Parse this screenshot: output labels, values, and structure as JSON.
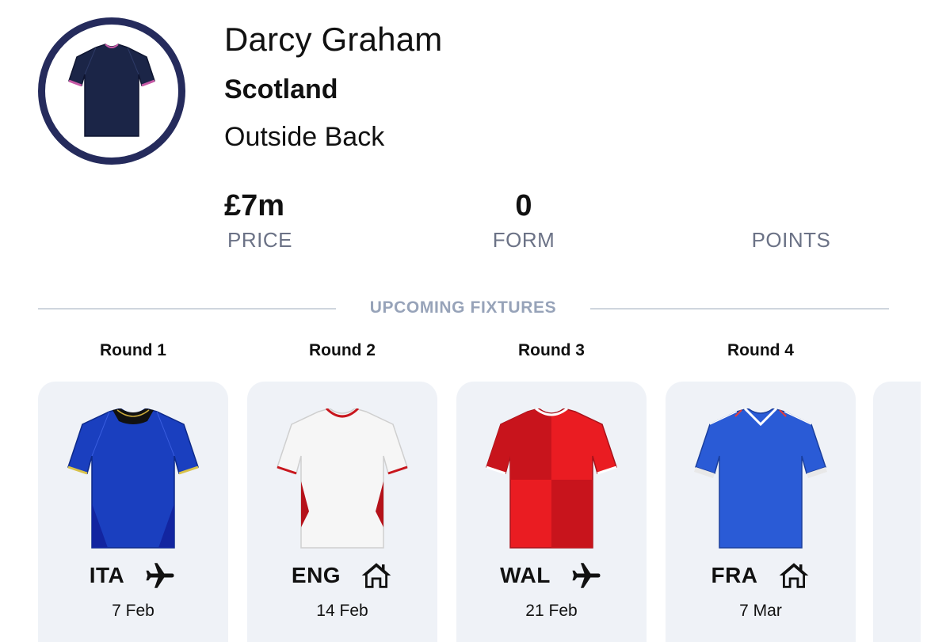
{
  "player": {
    "name": "Darcy Graham",
    "team": "Scotland",
    "position": "Outside Back",
    "jersey_color": "#1b2547"
  },
  "stats": {
    "price_value": "£7m",
    "price_label": "PRICE",
    "form_value": "0",
    "form_label": "FORM",
    "points_value": "",
    "points_label": "POINTS"
  },
  "fixtures": {
    "title": "UPCOMING FIXTURES",
    "items": [
      {
        "round": "Round 1",
        "opponent": "ITA",
        "venue": "away",
        "venue_icon": "airplane-icon",
        "date": "7 Feb",
        "jersey_color": "#1a3fbf"
      },
      {
        "round": "Round 2",
        "opponent": "ENG",
        "venue": "home",
        "venue_icon": "home-icon",
        "date": "14 Feb",
        "jersey_color": "#f5f5f5"
      },
      {
        "round": "Round 3",
        "opponent": "WAL",
        "venue": "away",
        "venue_icon": "airplane-icon",
        "date": "21 Feb",
        "jersey_color": "#e0181d"
      },
      {
        "round": "Round 4",
        "opponent": "FRA",
        "venue": "home",
        "venue_icon": "home-icon",
        "date": "7 Mar",
        "jersey_color": "#2a5bd6"
      }
    ]
  },
  "colors": {
    "avatar_ring": "#252b5c",
    "card_bg": "#eff2f7",
    "muted_text": "#6b7286",
    "section_title": "#97a3b9"
  }
}
